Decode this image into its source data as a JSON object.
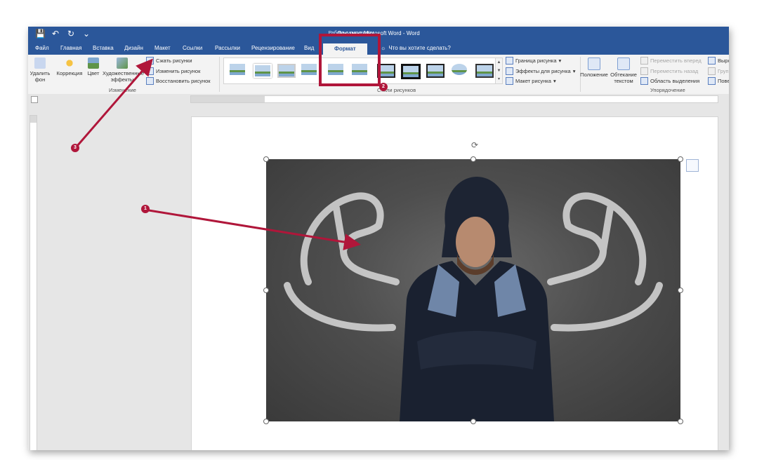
{
  "window": {
    "title": "Документ Microsoft Word - Word",
    "context_title": "Работа с рисунками"
  },
  "tabs": [
    {
      "label": "Файл"
    },
    {
      "label": "Главная"
    },
    {
      "label": "Вставка"
    },
    {
      "label": "Дизайн"
    },
    {
      "label": "Макет"
    },
    {
      "label": "Ссылки"
    },
    {
      "label": "Рассылки"
    },
    {
      "label": "Рецензирование"
    },
    {
      "label": "Вид"
    },
    {
      "label": "Формат",
      "active": true
    }
  ],
  "tell_me": "Что вы хотите сделать?",
  "ribbon": {
    "remove_bg": "Удалить фон",
    "correction": "Коррекция",
    "color": "Цвет",
    "artistic": "Художественные эффекты",
    "compress": "Сжать рисунки",
    "change": "Изменить рисунок",
    "reset": "Восстановить рисунок",
    "group_adjust": "Изменение",
    "group_styles": "Стили рисунков",
    "border": "Граница рисунка",
    "effects": "Эффекты для рисунка",
    "layout": "Макет рисунка",
    "position": "Положение",
    "wrap": "Обтекание текстом",
    "bring_forward": "Переместить вперед",
    "send_backward": "Переместить назад",
    "selection_pane": "Область выделения",
    "group_arrange": "Упорядочение",
    "align": "Выро",
    "group": "Груп",
    "rotate": "Пове"
  },
  "annotations": [
    {
      "number": "1"
    },
    {
      "number": "2"
    },
    {
      "number": "3"
    }
  ],
  "colors": {
    "word_blue": "#2b579a",
    "annotation_red": "#b0163a"
  }
}
